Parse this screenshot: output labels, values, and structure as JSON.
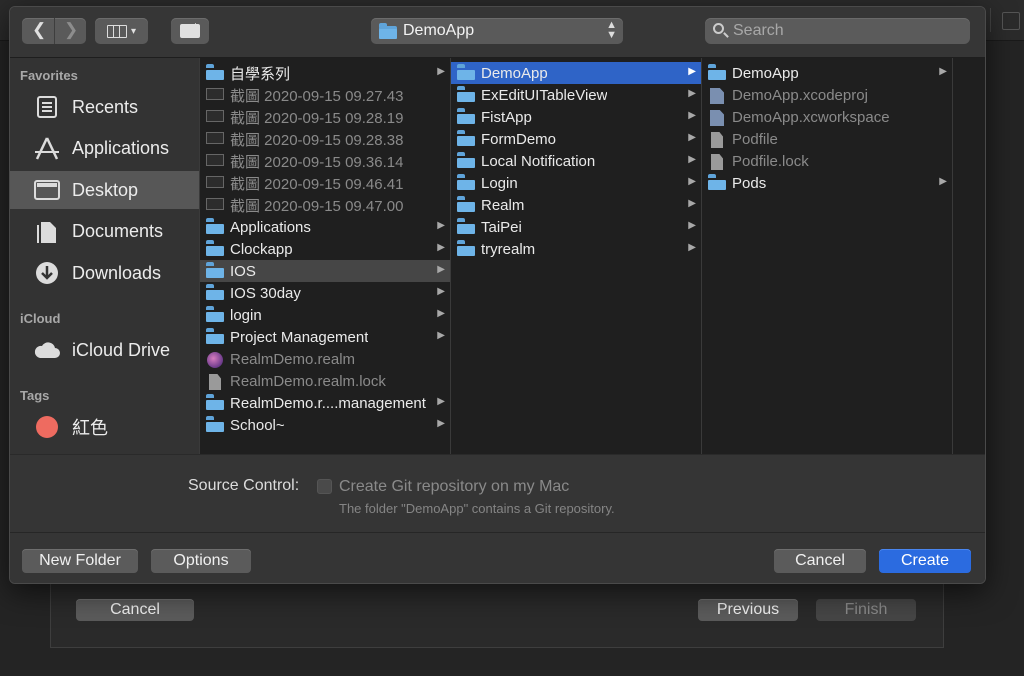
{
  "toolbar": {
    "location": "DemoApp",
    "search_placeholder": "Search"
  },
  "sidebar": {
    "favorites_header": "Favorites",
    "favorites": [
      {
        "label": "Recents",
        "icon": "clock-icon"
      },
      {
        "label": "Applications",
        "icon": "applications-icon"
      },
      {
        "label": "Desktop",
        "icon": "desktop-icon",
        "selected": true
      },
      {
        "label": "Documents",
        "icon": "documents-icon"
      },
      {
        "label": "Downloads",
        "icon": "downloads-icon"
      }
    ],
    "icloud_header": "iCloud",
    "icloud": [
      {
        "label": "iCloud Drive",
        "icon": "cloud-icon"
      }
    ],
    "tags_header": "Tags",
    "tags": [
      {
        "label": "紅色",
        "color": "#ee6b60"
      }
    ]
  },
  "column1": [
    {
      "label": "自學系列",
      "type": "folder",
      "arrow": true
    },
    {
      "label": "截圖 2020-09-15 09.27.43",
      "type": "screenshot",
      "dim": true
    },
    {
      "label": "截圖 2020-09-15 09.28.19",
      "type": "screenshot",
      "dim": true
    },
    {
      "label": "截圖 2020-09-15 09.28.38",
      "type": "screenshot",
      "dim": true
    },
    {
      "label": "截圖 2020-09-15 09.36.14",
      "type": "screenshot",
      "dim": true
    },
    {
      "label": "截圖 2020-09-15 09.46.41",
      "type": "screenshot",
      "dim": true
    },
    {
      "label": "截圖 2020-09-15 09.47.00",
      "type": "screenshot",
      "dim": true
    },
    {
      "label": "Applications",
      "type": "folder",
      "arrow": true
    },
    {
      "label": "Clockapp",
      "type": "folder",
      "arrow": true
    },
    {
      "label": "IOS",
      "type": "folder",
      "arrow": true,
      "selected": true
    },
    {
      "label": "IOS 30day",
      "type": "folder",
      "arrow": true
    },
    {
      "label": "login",
      "type": "folder",
      "arrow": true
    },
    {
      "label": "Project Management",
      "type": "folder",
      "arrow": true
    },
    {
      "label": "RealmDemo.realm",
      "type": "realm",
      "dim": true
    },
    {
      "label": "RealmDemo.realm.lock",
      "type": "doc",
      "dim": true
    },
    {
      "label": "RealmDemo.r....management",
      "type": "folder",
      "arrow": true
    },
    {
      "label": "School~",
      "type": "folder",
      "arrow": true
    }
  ],
  "column2": [
    {
      "label": "DemoApp",
      "type": "folder",
      "arrow": true,
      "active": true
    },
    {
      "label": "ExEditUITableView",
      "type": "folder",
      "arrow": true
    },
    {
      "label": "FistApp",
      "type": "folder",
      "arrow": true
    },
    {
      "label": "FormDemo",
      "type": "folder",
      "arrow": true
    },
    {
      "label": "Local Notification",
      "type": "folder",
      "arrow": true
    },
    {
      "label": "Login",
      "type": "folder",
      "arrow": true
    },
    {
      "label": "Realm",
      "type": "folder",
      "arrow": true
    },
    {
      "label": "TaiPei",
      "type": "folder",
      "arrow": true
    },
    {
      "label": "tryrealm",
      "type": "folder",
      "arrow": true
    }
  ],
  "column3": [
    {
      "label": "DemoApp",
      "type": "folder",
      "arrow": true
    },
    {
      "label": "DemoApp.xcodeproj",
      "type": "xcode",
      "dim": true
    },
    {
      "label": "DemoApp.xcworkspace",
      "type": "xcode",
      "dim": true
    },
    {
      "label": "Podfile",
      "type": "doc",
      "dim": true
    },
    {
      "label": "Podfile.lock",
      "type": "doc",
      "dim": true
    },
    {
      "label": "Pods",
      "type": "folder",
      "arrow": true
    }
  ],
  "source_control": {
    "label": "Source Control:",
    "checkbox_label": "Create Git repository on my Mac",
    "note": "The folder \"DemoApp\" contains a Git repository."
  },
  "buttons": {
    "new_folder": "New Folder",
    "options": "Options",
    "cancel": "Cancel",
    "create": "Create"
  },
  "background_sheet": {
    "cancel": "Cancel",
    "previous": "Previous",
    "finish": "Finish"
  }
}
